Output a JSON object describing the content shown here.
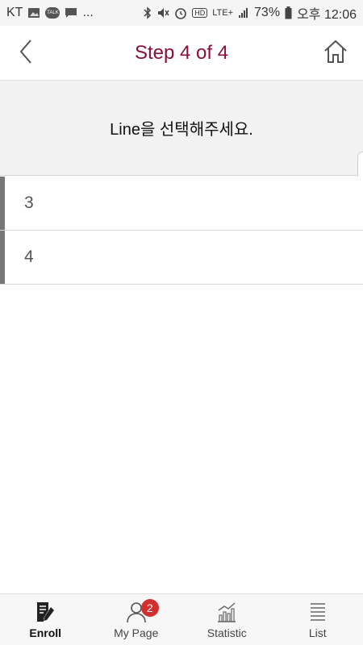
{
  "status_bar": {
    "carrier": "KT",
    "more": "...",
    "talk": "TALK",
    "hd": "HD",
    "network": "LTE+",
    "battery": "73%",
    "time": "오후 12:06"
  },
  "header": {
    "title": "Step 4 of 4"
  },
  "prompt": {
    "text": "Line을 선택해주세요."
  },
  "lines": [
    {
      "label": "3"
    },
    {
      "label": "4"
    }
  ],
  "bottom_nav": {
    "items": [
      {
        "label": "Enroll",
        "icon": "edit-document-icon",
        "active": true
      },
      {
        "label": "My Page",
        "icon": "user-icon",
        "badge": "2"
      },
      {
        "label": "Statistic",
        "icon": "bar-chart-icon"
      },
      {
        "label": "List",
        "icon": "list-icon"
      }
    ]
  },
  "colors": {
    "title": "#8a0f3b",
    "badge": "#d32f2f",
    "prompt_bg": "#f2f2f2",
    "item_bar": "#777777"
  }
}
